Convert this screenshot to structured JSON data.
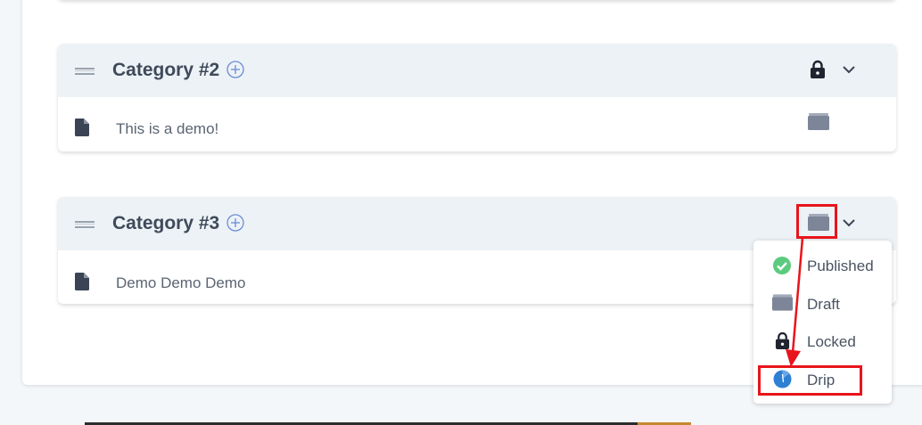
{
  "categories": [
    {
      "title": "Category #2",
      "status": "locked",
      "lessons": [
        {
          "title": "This is a demo!",
          "status": "draft"
        }
      ]
    },
    {
      "title": "Category #3",
      "status": "draft",
      "lessons": [
        {
          "title": "Demo Demo Demo"
        }
      ]
    }
  ],
  "status_menu": {
    "items": [
      {
        "label": "Published",
        "icon": "check-circle-icon",
        "color": "#5ccb7f"
      },
      {
        "label": "Draft",
        "icon": "folder-icon",
        "color": "#7d8698"
      },
      {
        "label": "Locked",
        "icon": "lock-icon",
        "color": "#1f2430"
      },
      {
        "label": "Drip",
        "icon": "clock-icon",
        "color": "#2f7fd4"
      }
    ],
    "highlighted": "Drip"
  },
  "colors": {
    "accent": "#6b8bd6",
    "annotation": "#e8141b",
    "header_bg": "#edf2f6"
  }
}
